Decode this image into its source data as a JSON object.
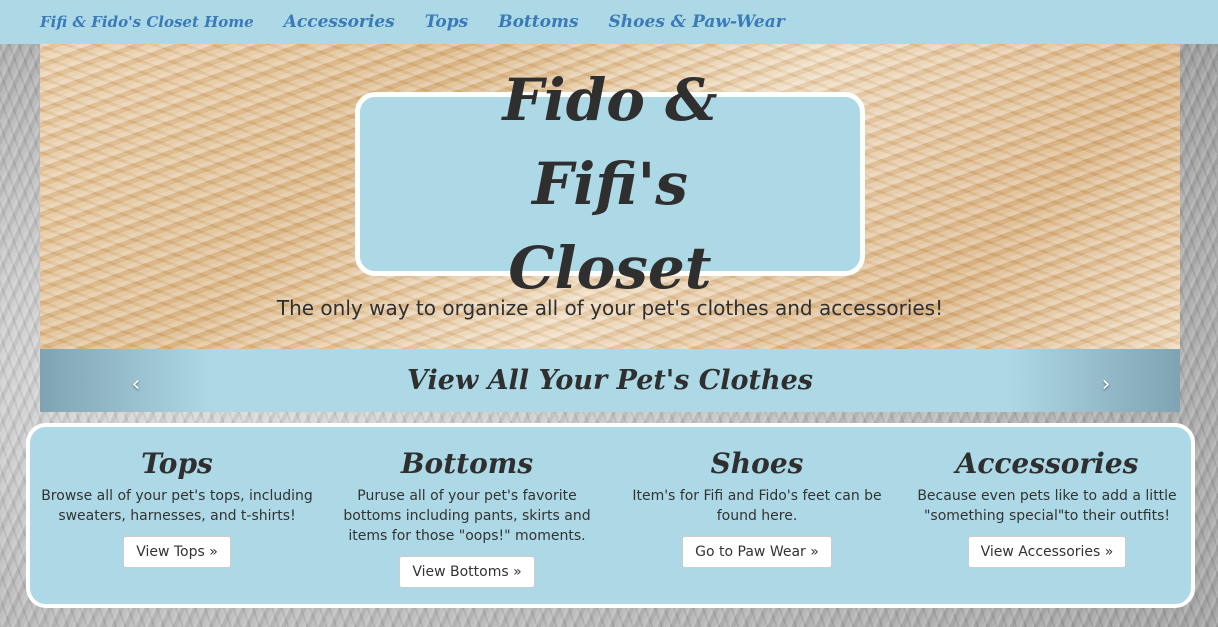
{
  "nav": {
    "items": [
      "Fifi & Fido's Closet Home",
      "Accessories",
      "Tops",
      "Bottoms",
      "Shoes & Paw-Wear"
    ]
  },
  "hero": {
    "title": "Fido & Fifi's Closet",
    "tagline": "The only way to organize all of your pet's clothes and accessories!"
  },
  "carousel": {
    "title": "View All Your Pet's Clothes",
    "prev": "‹",
    "next": "›"
  },
  "categories": [
    {
      "heading": "Tops",
      "text": "Browse all of your pet's tops, including sweaters, harnesses, and t-shirts!",
      "button": "View Tops »"
    },
    {
      "heading": "Bottoms",
      "text": "Puruse all of your pet's favorite bottoms including pants, skirts and items for those \"oops!\" moments.",
      "button": "View Bottoms »"
    },
    {
      "heading": "Shoes",
      "text": "Item's for Fifi and Fido's feet can be found here.",
      "button": "Go to Paw Wear »"
    },
    {
      "heading": "Accessories",
      "text": "Because even pets like to add a little \"something special\"to their outfits!",
      "button": "View Accessories »"
    }
  ],
  "colors": {
    "accent": "#add8e6",
    "link": "#3a7ab8",
    "text": "#2f2f2f"
  }
}
